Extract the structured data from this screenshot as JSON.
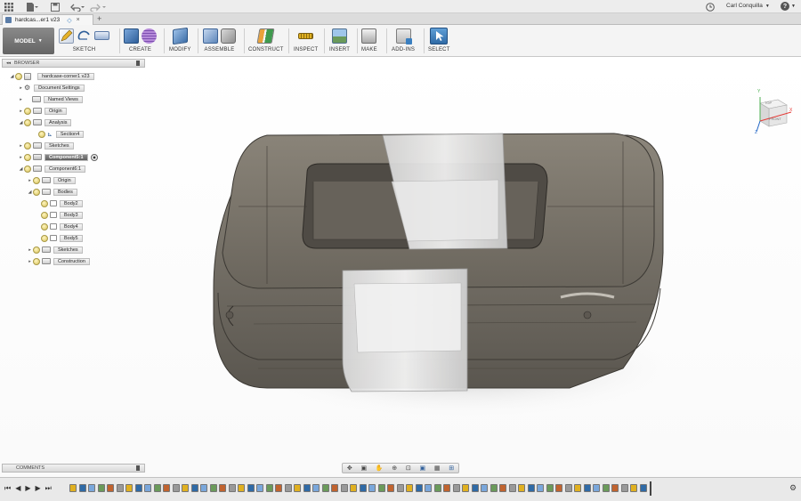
{
  "app": {
    "doc_tab_title": "hardcas...er1 v23",
    "user_name": "Carl Conquilla",
    "help_label": "?"
  },
  "toolbar": {
    "workspace": "MODEL",
    "groups": [
      {
        "label": "SKETCH",
        "icons": [
          "sketch-pencil-icon",
          "sketch-arc-icon",
          "stop-sketch-icon"
        ]
      },
      {
        "label": "CREATE",
        "icons": [
          "box-icon",
          "sphere-icon"
        ]
      },
      {
        "label": "MODIFY",
        "icons": [
          "press-pull-icon"
        ]
      },
      {
        "label": "ASSEMBLE",
        "icons": [
          "new-component-icon",
          "joint-icon"
        ]
      },
      {
        "label": "CONSTRUCT",
        "icons": [
          "offset-plane-icon"
        ]
      },
      {
        "label": "INSPECT",
        "icons": [
          "measure-icon"
        ]
      },
      {
        "label": "INSERT",
        "icons": [
          "insert-image-icon"
        ]
      },
      {
        "label": "MAKE",
        "icons": [
          "3d-print-icon"
        ]
      },
      {
        "label": "ADD-INS",
        "icons": [
          "scripts-icon"
        ]
      },
      {
        "label": "SELECT",
        "icons": [
          "select-arrow-icon"
        ]
      }
    ]
  },
  "browser": {
    "title": "BROWSER",
    "nodes": [
      {
        "label": "hardcase-corner1 v23",
        "depth": 0,
        "expanded": true,
        "active": false
      },
      {
        "label": "Document Settings",
        "depth": 1,
        "expanded": false,
        "active": false
      },
      {
        "label": "Named Views",
        "depth": 1,
        "expanded": false,
        "active": false
      },
      {
        "label": "Origin",
        "depth": 1,
        "expanded": false,
        "active": false
      },
      {
        "label": "Analysis",
        "depth": 1,
        "expanded": true,
        "active": false
      },
      {
        "label": "Section4",
        "depth": 2,
        "expanded": null,
        "active": false
      },
      {
        "label": "Sketches",
        "depth": 1,
        "expanded": false,
        "active": false
      },
      {
        "label": "Component5:1",
        "depth": 1,
        "expanded": false,
        "active": true
      },
      {
        "label": "Component6:1",
        "depth": 1,
        "expanded": true,
        "active": false
      },
      {
        "label": "Origin",
        "depth": 2,
        "expanded": false,
        "active": false
      },
      {
        "label": "Bodies",
        "depth": 2,
        "expanded": true,
        "active": false
      },
      {
        "label": "Body2",
        "depth": 3,
        "expanded": null,
        "active": false
      },
      {
        "label": "Body3",
        "depth": 3,
        "expanded": null,
        "active": false
      },
      {
        "label": "Body4",
        "depth": 3,
        "expanded": null,
        "active": false
      },
      {
        "label": "Body5",
        "depth": 3,
        "expanded": null,
        "active": false
      },
      {
        "label": "Sketches",
        "depth": 2,
        "expanded": false,
        "active": false
      },
      {
        "label": "Construction",
        "depth": 2,
        "expanded": false,
        "active": false
      }
    ]
  },
  "comments": {
    "title": "COMMENTS"
  },
  "viewcube": {
    "top": "TOP",
    "front": "FRONT",
    "axis_x": "X",
    "axis_y": "Y",
    "axis_z": "Z"
  },
  "colors": {
    "model_body": "#7a746a",
    "model_dark": "#5f5a52",
    "model_glass": "#e6e6e6",
    "accent_select": "#3a7fc0"
  }
}
